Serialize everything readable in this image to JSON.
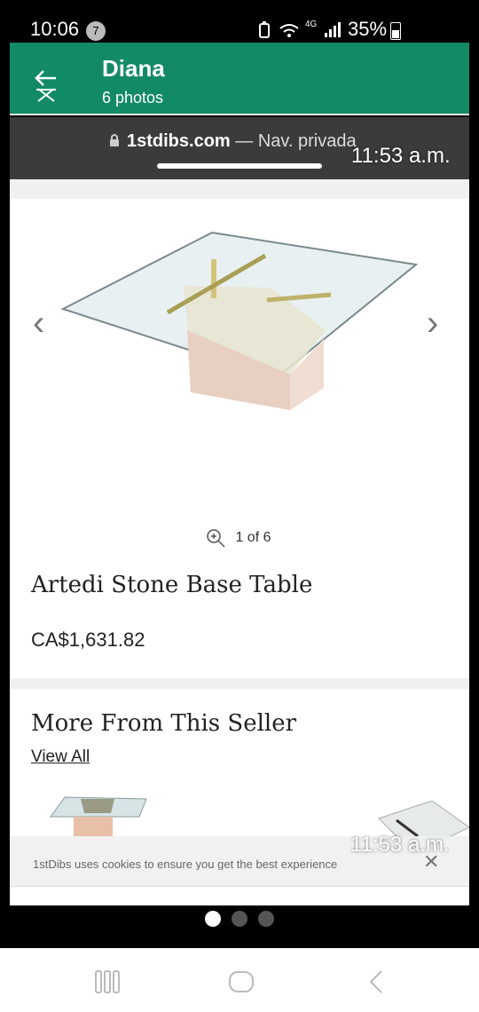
{
  "status_bar": {
    "time": "10:06",
    "notification_count": "7",
    "network": "4G",
    "battery": "35%"
  },
  "app_bar": {
    "title": "Diana",
    "subtitle": "6 photos"
  },
  "url_bar": {
    "host": "1stdibs.com",
    "suffix": " — Nav. privada",
    "overlay_time": "11:53 a.m."
  },
  "product": {
    "photo_counter": "1 of 6",
    "title": "Artedi Stone Base Table",
    "price": "CA$1,631.82"
  },
  "seller_section": {
    "heading": "More From This Seller",
    "view_all": "View All"
  },
  "cookie_banner": {
    "text": "1stDibs uses cookies to ensure you get the best experience",
    "overlay_time": "11:53 a.m."
  },
  "colors": {
    "app_bar": "#138a66",
    "url_bar": "#3b3b3b"
  }
}
